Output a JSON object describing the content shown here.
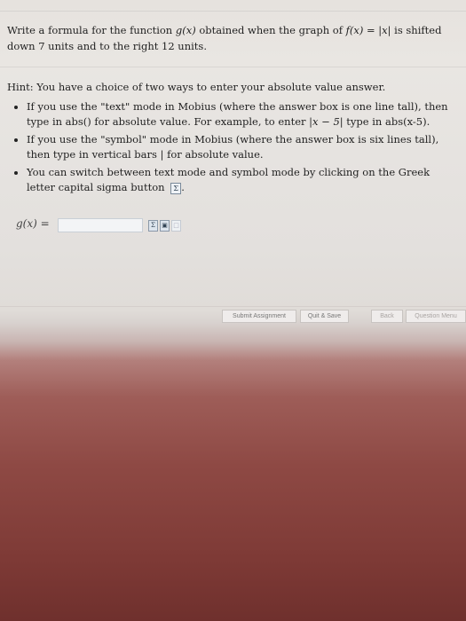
{
  "question": {
    "text_1": "Write a formula for the function ",
    "func_g": "g(x)",
    "text_2": " obtained when the graph of ",
    "func_f": "f(x) = |x|",
    "text_3": " is shifted down 7 units and to the right 12 units."
  },
  "hint": {
    "intro": "Hint: You have a choice of two ways to enter your absolute value answer.",
    "bullet_1_a": "If you use the \"text\" mode in Mobius (where the answer box is one line tall), then type in abs() for absolute value. For example, to enter ",
    "bullet_1_math": "|x − 5|",
    "bullet_1_b": " type in abs(x-5).",
    "bullet_2": "If you use the \"symbol\" mode in Mobius (where the answer box is six lines tall), then type in vertical bars | for absolute value.",
    "bullet_3": "You can switch between text mode and symbol mode by clicking on the Greek letter capital sigma button",
    "bullet_3_end": "."
  },
  "answer": {
    "label": "g(x) =",
    "value": "",
    "placeholder": ""
  },
  "footer": {
    "submit_label": "Submit Assignment",
    "quit_label": "Quit & Save",
    "back_label": "Back",
    "question_menu_label": "Question Menu"
  }
}
